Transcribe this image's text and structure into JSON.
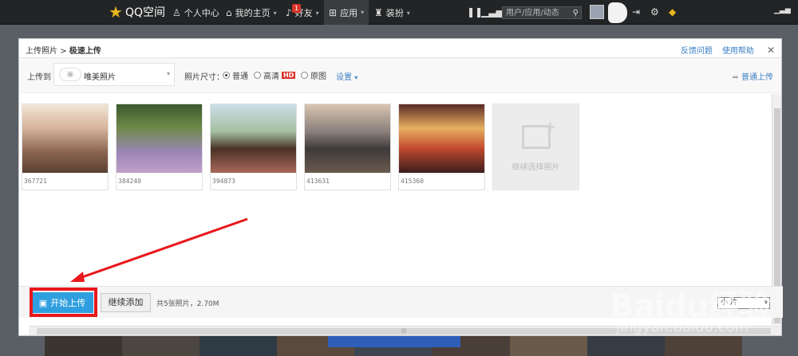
{
  "topbar": {
    "logo_text": "QQ空间",
    "nav": [
      {
        "label": "个人中心",
        "icon": "person-icon"
      },
      {
        "label": "我的主页",
        "icon": "home-icon",
        "caret": "▾"
      },
      {
        "label": "好友",
        "icon": "bell-icon",
        "caret": "▾",
        "badge": "1"
      },
      {
        "label": "应用",
        "icon": "grid-icon",
        "caret": "▾"
      },
      {
        "label": "装扮",
        "icon": "shirt-icon",
        "caret": "▾"
      }
    ],
    "search_placeholder": "用户/应用/动态"
  },
  "dialog": {
    "breadcrumb_parent": "上传照片",
    "breadcrumb_sep": ">",
    "breadcrumb_current": "极速上传",
    "feedback_link": "反馈问题",
    "help_link": "使用帮助",
    "close_glyph": "✕",
    "upload_to_label": "上传到",
    "album_name": "唯美照片",
    "size_label": "照片尺寸：",
    "size_options": [
      {
        "label": "普通",
        "checked": true
      },
      {
        "label": "高清",
        "checked": false,
        "badge": "HD"
      },
      {
        "label": "原图",
        "checked": false
      }
    ],
    "settings_link": "设置",
    "normal_upload_link": "普通上传",
    "photos": [
      {
        "size": "367721"
      },
      {
        "size": "384240"
      },
      {
        "size": "394873"
      },
      {
        "size": "413631"
      },
      {
        "size": "415360"
      }
    ],
    "add_more_label": "继续选择照片",
    "start_upload": "开始上传",
    "continue_add": "继续添加",
    "summary": "共5张照片，2.70M",
    "bottom_select": "小  片"
  },
  "watermark": {
    "brand": "Baidu经验",
    "url": "jingyan.baidu.com"
  },
  "colors": {
    "accent": "#2f9fe0",
    "highlight": "#e8181c",
    "link": "#3b7fc4"
  }
}
